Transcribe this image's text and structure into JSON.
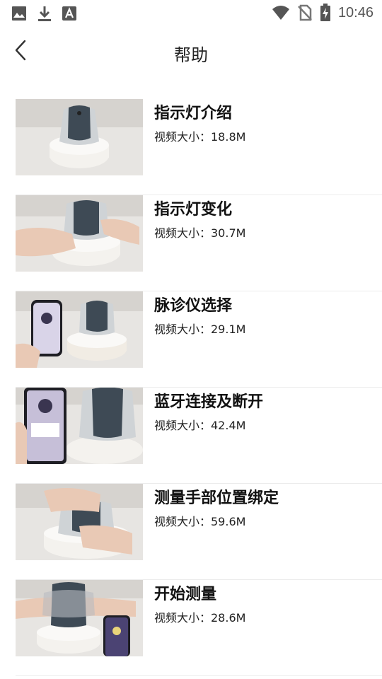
{
  "status_bar": {
    "time": "10:46",
    "left_icons": [
      "image-icon",
      "download-icon",
      "font-a-icon"
    ],
    "right_icons": [
      "wifi-icon",
      "no-sim-icon",
      "battery-charging-icon"
    ]
  },
  "header": {
    "title": "帮助",
    "back_icon": "chevron-left-icon"
  },
  "videos": [
    {
      "title": "指示灯介绍",
      "size": "视频大小：18.8M"
    },
    {
      "title": "指示灯变化",
      "size": "视频大小：30.7M"
    },
    {
      "title": "脉诊仪选择",
      "size": "视频大小：29.1M"
    },
    {
      "title": "蓝牙连接及断开",
      "size": "视频大小：42.4M"
    },
    {
      "title": "测量手部位置绑定",
      "size": "视频大小：59.6M"
    },
    {
      "title": "开始测量",
      "size": "视频大小：28.6M"
    }
  ]
}
